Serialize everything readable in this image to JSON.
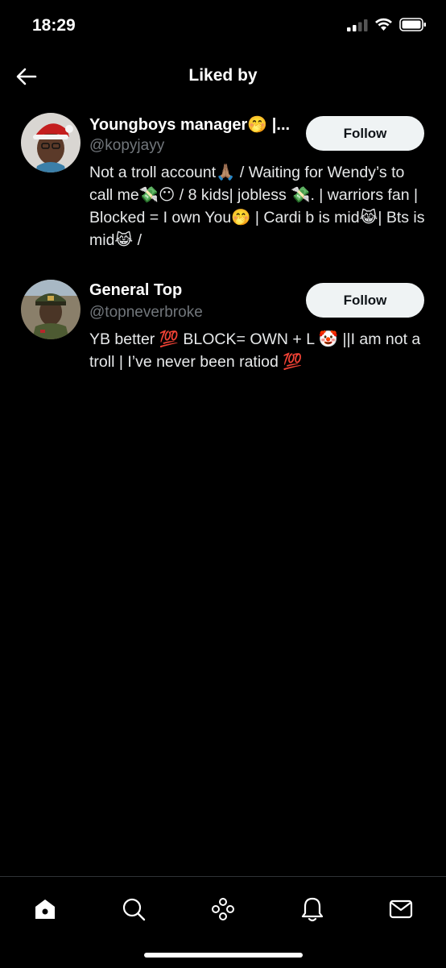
{
  "status_bar": {
    "time": "18:29"
  },
  "header": {
    "title": "Liked by",
    "back_icon": "arrow-left-icon"
  },
  "users": [
    {
      "name": "Youngboys manager🤭 |...",
      "handle": "@kopyjayy",
      "bio": "Not a troll account🙏🏽 / Waiting for Wendy’s to call me💸😶 / 8 kids| jobless 💸. | warriors fan | Blocked = I own You🤭 | Cardi b is mid😹| Bts is mid😹 /",
      "follow_label": "Follow"
    },
    {
      "name": "General Top",
      "handle": "@topneverbroke",
      "bio": "YB better 💯 BLOCK= OWN + L 🤡 ||I am not a troll | I’ve never been ratiod 💯",
      "follow_label": "Follow"
    }
  ],
  "tab_bar": {
    "tabs": [
      "home-icon",
      "search-icon",
      "communities-icon",
      "notifications-icon",
      "messages-icon"
    ]
  },
  "colors": {
    "background": "#000000",
    "text": "#e7e9ea",
    "secondary_text": "#71767b",
    "follow_button_bg": "#eff3f4",
    "follow_button_text": "#0f1419"
  }
}
